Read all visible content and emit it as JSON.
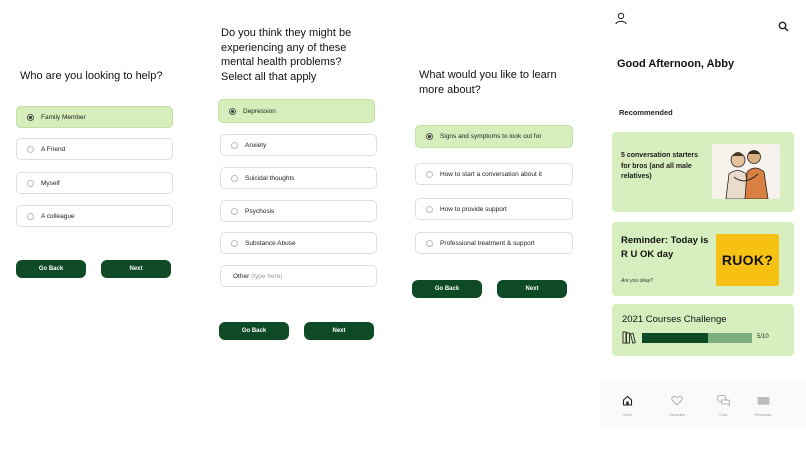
{
  "screen1": {
    "question": "Who are you looking to help?",
    "options": [
      {
        "label": "Family Member",
        "selected": true
      },
      {
        "label": "A Friend",
        "selected": false
      },
      {
        "label": "Myself",
        "selected": false
      },
      {
        "label": "A colleague",
        "selected": false
      }
    ],
    "back_label": "Go Back",
    "next_label": "Next"
  },
  "screen2": {
    "question_lines": [
      "Do you think they might be",
      "experiencing any of these",
      "mental health problems?",
      "Select all that apply"
    ],
    "options": [
      {
        "label": "Depression",
        "selected": true
      },
      {
        "label": "Anxiety",
        "selected": false
      },
      {
        "label": "Suicidal thoughts",
        "selected": false
      },
      {
        "label": "Psychosis",
        "selected": false
      },
      {
        "label": "Substance Abuse",
        "selected": false
      }
    ],
    "other_label": "Other",
    "other_placeholder": "(type here)",
    "back_label": "Go Back",
    "next_label": "Next"
  },
  "screen3": {
    "question_lines": [
      "What would you like to learn",
      "more about?"
    ],
    "options": [
      {
        "label": "Signs and symptoms to look out for",
        "selected": true
      },
      {
        "label": "How to start a conversation about it",
        "selected": false
      },
      {
        "label": "How to provide support",
        "selected": false
      },
      {
        "label": "Professional treatment & support",
        "selected": false
      }
    ],
    "back_label": "Go Back",
    "next_label": "Next"
  },
  "home": {
    "greeting": "Good Afternoon, Abby",
    "recommended_label": "Recommended",
    "card1_text": "5 conversation starters for bros (and all male relatives)",
    "card2_title": "Reminder: Today is R U OK day",
    "card2_subtitle": "Are you okay?",
    "ruok_logo": "RUOK?",
    "challenge_title": "2021 Courses Challenge",
    "challenge_progress": "5/10",
    "challenge_fraction": 0.5,
    "nav": [
      {
        "label": "Home",
        "icon": "home-icon"
      },
      {
        "label": "Favourites",
        "icon": "heart-icon"
      },
      {
        "label": "Chat",
        "icon": "chat-icon"
      },
      {
        "label": "Resources",
        "icon": "book-icon"
      }
    ]
  },
  "colors": {
    "accent_dark_green": "#0f4a26",
    "selected_light_green": "#d6eebb",
    "card_green": "#d7efbe",
    "ruok_yellow": "#f7c113"
  }
}
